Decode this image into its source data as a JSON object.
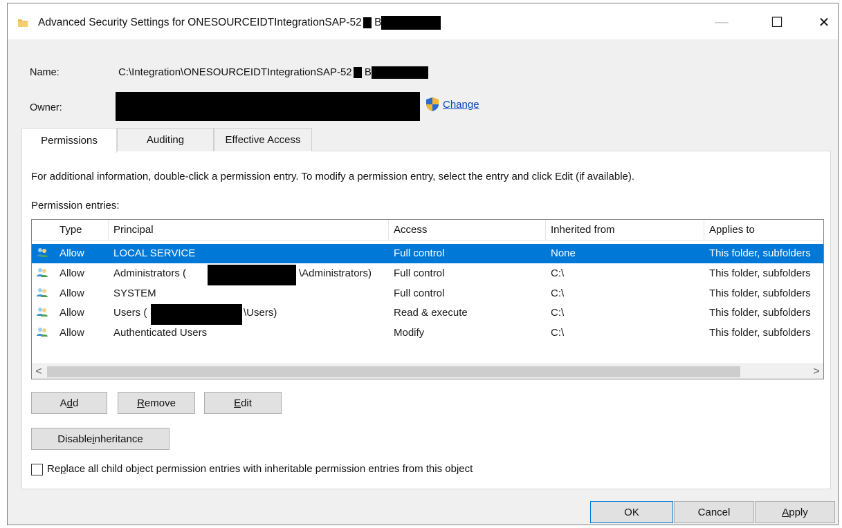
{
  "window": {
    "title": "Advanced Security Settings for ONESOURCEIDTIntegrationSAP-52",
    "title_suffix": "B",
    "controls": {
      "minimize": "—",
      "maximize": "☐",
      "close": "✕"
    }
  },
  "fields": {
    "name_label": "Name:",
    "name_value": "C:\\Integration\\ONESOURCEIDTIntegrationSAP-52",
    "name_suffix": "B",
    "owner_label": "Owner:",
    "change_link": "Change"
  },
  "tabs": [
    {
      "label": "Permissions",
      "active": true
    },
    {
      "label": "Auditing",
      "active": false
    },
    {
      "label": "Effective Access",
      "active": false
    }
  ],
  "info_text": "For additional information, double-click a permission entry. To modify a permission entry, select the entry and click Edit (if available).",
  "entries_label": "Permission entries:",
  "table": {
    "columns": [
      "Type",
      "Principal",
      "Access",
      "Inherited from",
      "Applies to"
    ],
    "rows": [
      {
        "type": "Allow",
        "principal": "LOCAL SERVICE",
        "principal_tail": "",
        "access": "Full control",
        "inherited": "None",
        "applies": "This folder, subfolders",
        "selected": true
      },
      {
        "type": "Allow",
        "principal": "Administrators (",
        "principal_tail": "\\Administrators)",
        "access": "Full control",
        "inherited": "C:\\",
        "applies": "This folder, subfolders",
        "selected": false
      },
      {
        "type": "Allow",
        "principal": "SYSTEM",
        "principal_tail": "",
        "access": "Full control",
        "inherited": "C:\\",
        "applies": "This folder, subfolders",
        "selected": false
      },
      {
        "type": "Allow",
        "principal": "Users (",
        "principal_tail": "\\Users)",
        "access": "Read & execute",
        "inherited": "C:\\",
        "applies": "This folder, subfolders",
        "selected": false
      },
      {
        "type": "Allow",
        "principal": "Authenticated Users",
        "principal_tail": "",
        "access": "Modify",
        "inherited": "C:\\",
        "applies": "This folder, subfolders",
        "selected": false
      }
    ]
  },
  "scroll": {
    "left": "<",
    "right": ">"
  },
  "buttons": {
    "add_pre": "A",
    "add_u": "d",
    "add_post": "d",
    "remove_u": "R",
    "remove_post": "emove",
    "edit_u": "E",
    "edit_post": "dit",
    "disable_pre": "Disable ",
    "disable_u": "i",
    "disable_post": "nheritance",
    "ok": "OK",
    "cancel": "Cancel",
    "apply_u": "A",
    "apply_post": "pply"
  },
  "checkbox": {
    "pre": "Re",
    "u": "p",
    "post": "lace all child object permission entries with inheritable permission entries from this object"
  },
  "colors": {
    "selection": "#0078d7",
    "link": "#0a44c2",
    "shield_blue": "#2a6bd1",
    "shield_gold": "#f2b632"
  }
}
